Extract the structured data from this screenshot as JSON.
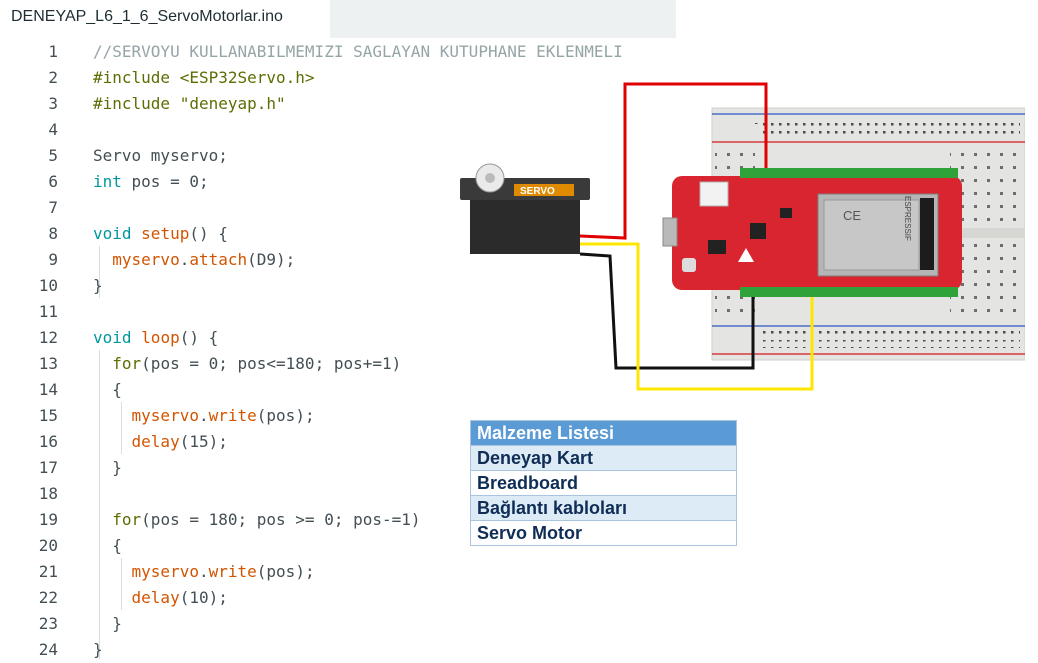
{
  "tab": {
    "filename": "DENEYAP_L6_1_6_ServoMotorlar.ino"
  },
  "editor": {
    "lines": [
      {
        "n": "1",
        "tokens": [
          {
            "t": "//SERVOYU KULLANABILMEMIZI SAGLAYAN KUTUPHANE EKLENMELI",
            "c": "cm"
          }
        ]
      },
      {
        "n": "2",
        "tokens": [
          {
            "t": "#include <ESP32Servo.h>",
            "c": "pp"
          }
        ]
      },
      {
        "n": "3",
        "tokens": [
          {
            "t": "#include \"deneyap.h\"",
            "c": "pp"
          }
        ]
      },
      {
        "n": "4",
        "tokens": []
      },
      {
        "n": "5",
        "tokens": [
          {
            "t": "Servo myservo;",
            "c": "tx"
          }
        ]
      },
      {
        "n": "6",
        "tokens": [
          {
            "t": "int",
            "c": "kw"
          },
          {
            "t": " pos = 0;",
            "c": "tx"
          }
        ]
      },
      {
        "n": "7",
        "tokens": []
      },
      {
        "n": "8",
        "tokens": [
          {
            "t": "void",
            "c": "kw"
          },
          {
            "t": " ",
            "c": "tx"
          },
          {
            "t": "setup",
            "c": "fn"
          },
          {
            "t": "() {",
            "c": "tx"
          }
        ]
      },
      {
        "n": "9",
        "tokens": [
          {
            "t": "  ",
            "c": "tx"
          },
          {
            "t": "myservo",
            "c": "fn"
          },
          {
            "t": ".",
            "c": "tx"
          },
          {
            "t": "attach",
            "c": "fn"
          },
          {
            "t": "(D9);",
            "c": "tx"
          }
        ]
      },
      {
        "n": "10",
        "tokens": [
          {
            "t": "}",
            "c": "tx"
          }
        ]
      },
      {
        "n": "11",
        "tokens": []
      },
      {
        "n": "12",
        "tokens": [
          {
            "t": "void",
            "c": "kw"
          },
          {
            "t": " ",
            "c": "tx"
          },
          {
            "t": "loop",
            "c": "fn"
          },
          {
            "t": "() {",
            "c": "tx"
          }
        ]
      },
      {
        "n": "13",
        "tokens": [
          {
            "t": "  ",
            "c": "tx"
          },
          {
            "t": "for",
            "c": "pp"
          },
          {
            "t": "(pos = 0; pos<=180; pos+=1)",
            "c": "tx"
          }
        ]
      },
      {
        "n": "14",
        "tokens": [
          {
            "t": "  {",
            "c": "tx"
          }
        ]
      },
      {
        "n": "15",
        "tokens": [
          {
            "t": "    ",
            "c": "tx"
          },
          {
            "t": "myservo",
            "c": "fn"
          },
          {
            "t": ".",
            "c": "tx"
          },
          {
            "t": "write",
            "c": "fn"
          },
          {
            "t": "(pos);",
            "c": "tx"
          }
        ]
      },
      {
        "n": "16",
        "tokens": [
          {
            "t": "    ",
            "c": "tx"
          },
          {
            "t": "delay",
            "c": "fn"
          },
          {
            "t": "(15);",
            "c": "tx"
          }
        ]
      },
      {
        "n": "17",
        "tokens": [
          {
            "t": "  }",
            "c": "tx"
          }
        ]
      },
      {
        "n": "18",
        "tokens": []
      },
      {
        "n": "19",
        "tokens": [
          {
            "t": "  ",
            "c": "tx"
          },
          {
            "t": "for",
            "c": "pp"
          },
          {
            "t": "(pos = 180; pos >= 0; pos-=1)",
            "c": "tx"
          }
        ]
      },
      {
        "n": "20",
        "tokens": [
          {
            "t": "  {",
            "c": "tx"
          }
        ]
      },
      {
        "n": "21",
        "tokens": [
          {
            "t": "    ",
            "c": "tx"
          },
          {
            "t": "myservo",
            "c": "fn"
          },
          {
            "t": ".",
            "c": "tx"
          },
          {
            "t": "write",
            "c": "fn"
          },
          {
            "t": "(pos);",
            "c": "tx"
          }
        ]
      },
      {
        "n": "22",
        "tokens": [
          {
            "t": "    ",
            "c": "tx"
          },
          {
            "t": "delay",
            "c": "fn"
          },
          {
            "t": "(10);",
            "c": "tx"
          }
        ]
      },
      {
        "n": "23",
        "tokens": [
          {
            "t": "  }",
            "c": "tx"
          }
        ]
      },
      {
        "n": "24",
        "tokens": [
          {
            "t": "}",
            "c": "tx"
          }
        ]
      }
    ]
  },
  "circuit": {
    "servo_label": "SERVO",
    "chip_brand": "ESPRESSIF",
    "ce_mark": "CE",
    "wire_colors": {
      "power": "#e00000",
      "ground": "#111111",
      "signal": "#ffe600"
    }
  },
  "materials": {
    "header": "Malzeme Listesi",
    "items": [
      "Deneyap Kart",
      "Breadboard",
      "Bağlantı kabloları",
      "Servo Motor"
    ]
  }
}
